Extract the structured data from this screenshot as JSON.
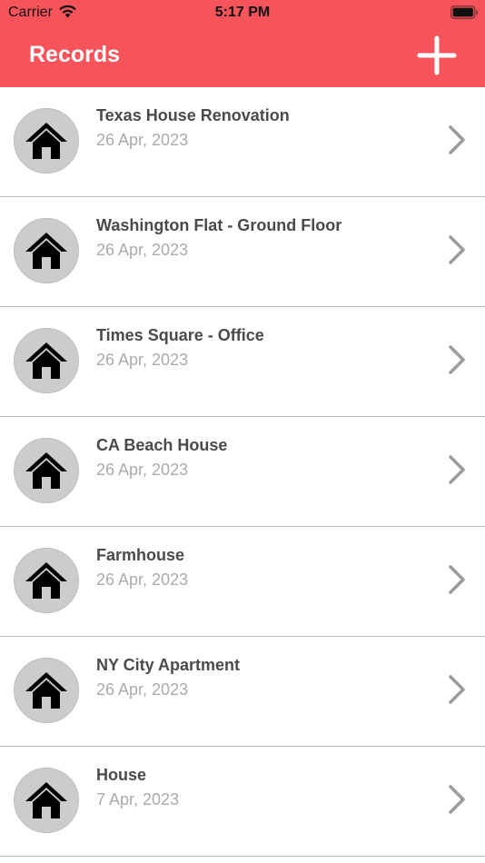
{
  "status_bar": {
    "carrier": "Carrier",
    "time": "5:17 PM"
  },
  "nav": {
    "title": "Records",
    "add_icon": "plus-icon"
  },
  "colors": {
    "header_bg": "#f7535b",
    "avatar_bg": "#cccccc",
    "title_text": "#4a4a4a",
    "date_text": "#ababab",
    "chevron": "#9b9b9b"
  },
  "records": [
    {
      "title": "Texas House Renovation",
      "date": "26 Apr, 2023",
      "icon": "house-icon"
    },
    {
      "title": "Washington Flat - Ground Floor",
      "date": "26 Apr, 2023",
      "icon": "house-icon"
    },
    {
      "title": "Times Square - Office",
      "date": "26 Apr, 2023",
      "icon": "house-icon"
    },
    {
      "title": "CA Beach House",
      "date": "26 Apr, 2023",
      "icon": "house-icon"
    },
    {
      "title": "Farmhouse",
      "date": "26 Apr, 2023",
      "icon": "house-icon"
    },
    {
      "title": "NY City Apartment",
      "date": "26 Apr, 2023",
      "icon": "house-icon"
    },
    {
      "title": "House",
      "date": "7 Apr, 2023",
      "icon": "house-icon"
    }
  ]
}
